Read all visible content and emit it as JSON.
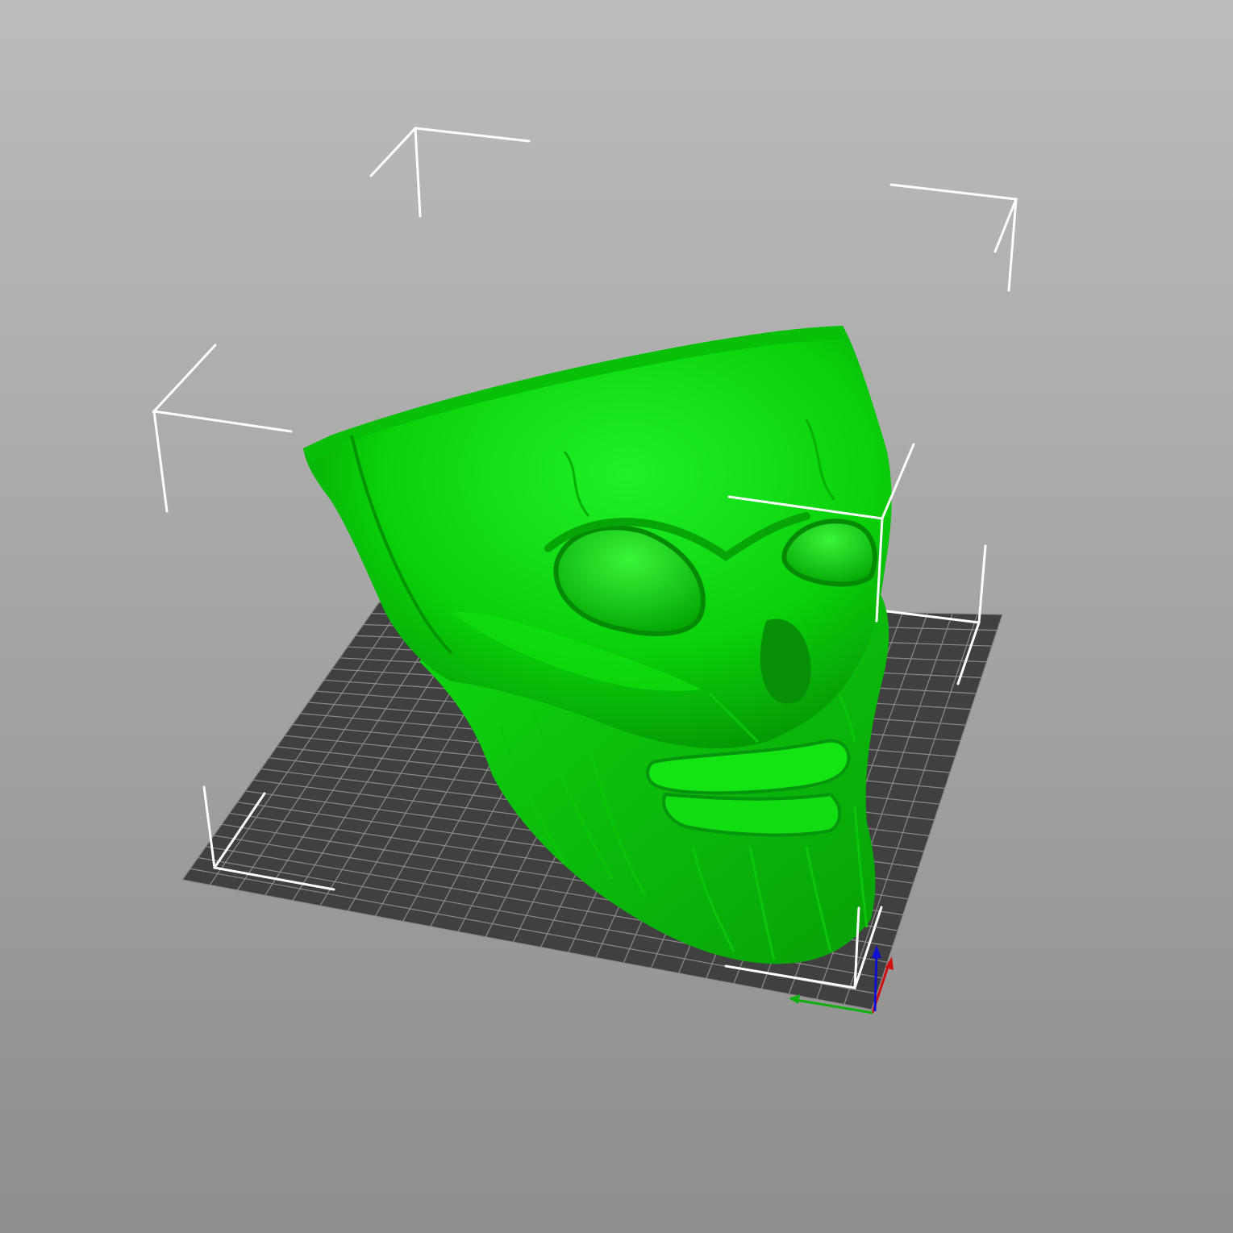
{
  "viewport": {
    "background_top": "#bcbcbc",
    "background_bottom": "#8e8e8e"
  },
  "bed": {
    "fill": "#404040",
    "grid_color": "#8a8a8a",
    "grid_divisions": 25
  },
  "model": {
    "color": "#0ad10a",
    "highlight": "#22f02a",
    "shadow": "#069006",
    "icon": "skull-icon"
  },
  "bounding_box": {
    "color": "#ffffff"
  },
  "axes": {
    "x_color": "#d01010",
    "y_color": "#10b010",
    "z_color": "#1010d0"
  }
}
